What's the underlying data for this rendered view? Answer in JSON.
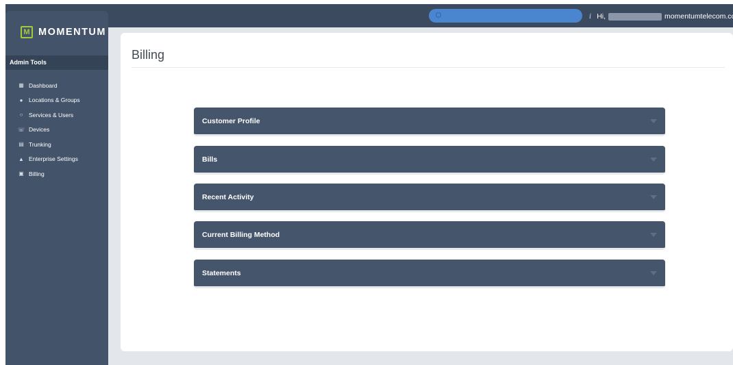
{
  "header": {
    "search_placeholder": "",
    "greeting_prefix": "Hi,",
    "greeting_domain": "momentumtelecom.co"
  },
  "brand": {
    "mark": "M",
    "name": "MOMENTUM",
    "accent_color": "#a4c93b"
  },
  "sidebar": {
    "section_title": "Admin Tools",
    "items": [
      {
        "label": "Dashboard",
        "icon": "grid-icon"
      },
      {
        "label": "Locations & Groups",
        "icon": "map-pin-icon"
      },
      {
        "label": "Services & Users",
        "icon": "users-icon"
      },
      {
        "label": "Devices",
        "icon": "phone-icon"
      },
      {
        "label": "Trunking",
        "icon": "server-icon"
      },
      {
        "label": "Enterprise Settings",
        "icon": "hierarchy-icon"
      },
      {
        "label": "Billing",
        "icon": "credit-card-icon"
      }
    ]
  },
  "main": {
    "title": "Billing",
    "sections": [
      {
        "label": "Customer Profile"
      },
      {
        "label": "Bills"
      },
      {
        "label": "Recent Activity"
      },
      {
        "label": "Current Billing Method"
      },
      {
        "label": "Statements"
      }
    ]
  },
  "colors": {
    "topbar": "#3c4a60",
    "sidebar": "#43536a",
    "panel": "#45556c",
    "search": "#4a86cf"
  }
}
